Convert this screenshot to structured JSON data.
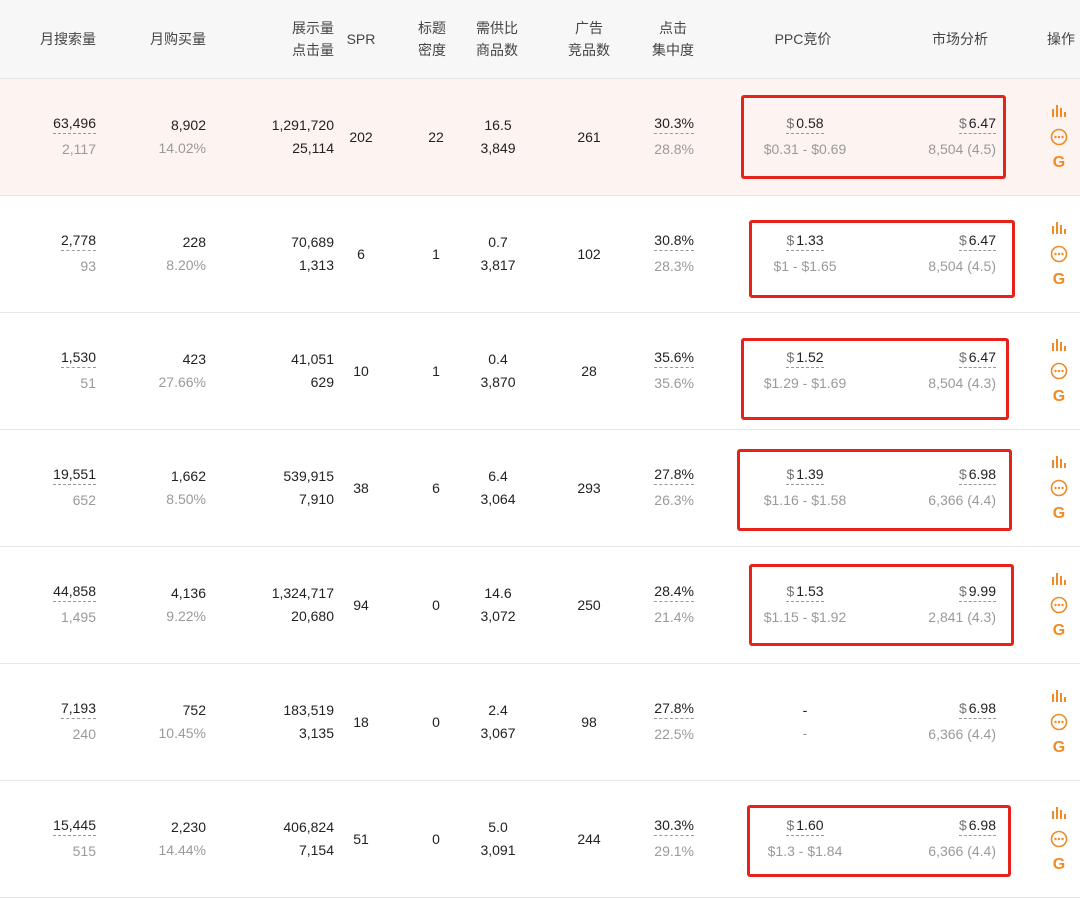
{
  "header": {
    "monthly_search": "月搜索量",
    "monthly_purchase": "月购买量",
    "impressions": "展示量",
    "clicks": "点击量",
    "spr": "SPR",
    "title_density_1": "标题",
    "title_density_2": "密度",
    "supply_demand_1": "需供比",
    "supply_demand_2": "商品数",
    "ads_1": "广告",
    "ads_2": "竞品数",
    "click_conc_1": "点击",
    "click_conc_2": "集中度",
    "ppc": "PPC竞价",
    "market": "市场分析",
    "ops": "操作"
  },
  "rows": [
    {
      "search": "63,496",
      "search_sub": "2,117",
      "purchase": "8,902",
      "purchase_rate": "14.02%",
      "impr": "1,291,720",
      "clicks": "25,114",
      "spr": "202",
      "density": "22",
      "ratio": "16.5",
      "products": "3,849",
      "ads": "261",
      "conc1": "30.3%",
      "conc2": "28.8%",
      "ppc": "0.58",
      "ppc_range": "$0.31 - $0.69",
      "market": "6.47",
      "market_sub": "8,504 (4.5)"
    },
    {
      "search": "2,778",
      "search_sub": "93",
      "purchase": "228",
      "purchase_rate": "8.20%",
      "impr": "70,689",
      "clicks": "1,313",
      "spr": "6",
      "density": "1",
      "ratio": "0.7",
      "products": "3,817",
      "ads": "102",
      "conc1": "30.8%",
      "conc2": "28.3%",
      "ppc": "1.33",
      "ppc_range": "$1 - $1.65",
      "market": "6.47",
      "market_sub": "8,504 (4.5)"
    },
    {
      "search": "1,530",
      "search_sub": "51",
      "purchase": "423",
      "purchase_rate": "27.66%",
      "impr": "41,051",
      "clicks": "629",
      "spr": "10",
      "density": "1",
      "ratio": "0.4",
      "products": "3,870",
      "ads": "28",
      "conc1": "35.6%",
      "conc2": "35.6%",
      "ppc": "1.52",
      "ppc_range": "$1.29 - $1.69",
      "market": "6.47",
      "market_sub": "8,504 (4.3)"
    },
    {
      "search": "19,551",
      "search_sub": "652",
      "purchase": "1,662",
      "purchase_rate": "8.50%",
      "impr": "539,915",
      "clicks": "7,910",
      "spr": "38",
      "density": "6",
      "ratio": "6.4",
      "products": "3,064",
      "ads": "293",
      "conc1": "27.8%",
      "conc2": "26.3%",
      "ppc": "1.39",
      "ppc_range": "$1.16 - $1.58",
      "market": "6.98",
      "market_sub": "6,366 (4.4)"
    },
    {
      "search": "44,858",
      "search_sub": "1,495",
      "purchase": "4,136",
      "purchase_rate": "9.22%",
      "impr": "1,324,717",
      "clicks": "20,680",
      "spr": "94",
      "density": "0",
      "ratio": "14.6",
      "products": "3,072",
      "ads": "250",
      "conc1": "28.4%",
      "conc2": "21.4%",
      "ppc": "1.53",
      "ppc_range": "$1.15 - $1.92",
      "market": "9.99",
      "market_sub": "2,841 (4.3)"
    },
    {
      "search": "7,193",
      "search_sub": "240",
      "purchase": "752",
      "purchase_rate": "10.45%",
      "impr": "183,519",
      "clicks": "3,135",
      "spr": "18",
      "density": "0",
      "ratio": "2.4",
      "products": "3,067",
      "ads": "98",
      "conc1": "27.8%",
      "conc2": "22.5%",
      "ppc": "-",
      "ppc_range": "-",
      "market": "6.98",
      "market_sub": "6,366 (4.4)"
    },
    {
      "search": "15,445",
      "search_sub": "515",
      "purchase": "2,230",
      "purchase_rate": "14.44%",
      "impr": "406,824",
      "clicks": "7,154",
      "spr": "51",
      "density": "0",
      "ratio": "5.0",
      "products": "3,091",
      "ads": "244",
      "conc1": "30.3%",
      "conc2": "29.1%",
      "ppc": "1.60",
      "ppc_range": "$1.3 - $1.84",
      "market": "6.98",
      "market_sub": "6,366 (4.4)"
    }
  ],
  "currency": "$",
  "colors": {
    "accent": "#f08a24",
    "highlight_box": "#e5231b",
    "highlight_row": "#fdf3f1"
  },
  "icons": [
    "bar-chart-icon",
    "more-icon",
    "google-icon"
  ]
}
